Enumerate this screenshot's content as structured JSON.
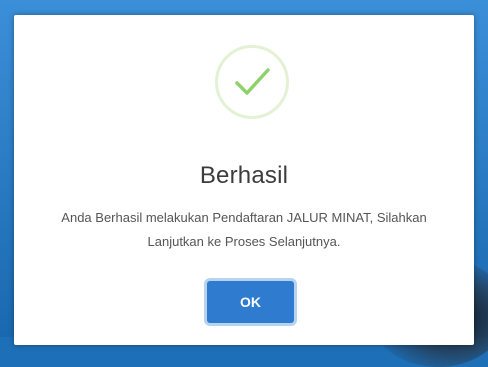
{
  "dialog": {
    "icon": "checkmark-success-icon",
    "title": "Berhasil",
    "message_line1": "Anda Berhasil melakukan Pendaftaran JALUR MINAT, Silahkan",
    "message_line2": "Lanjutkan ke Proses Selanjutnya.",
    "ok_label": "OK"
  },
  "colors": {
    "success": "#8fd16a",
    "button": "#2f7bd0",
    "frame": "#1d6fb8"
  }
}
